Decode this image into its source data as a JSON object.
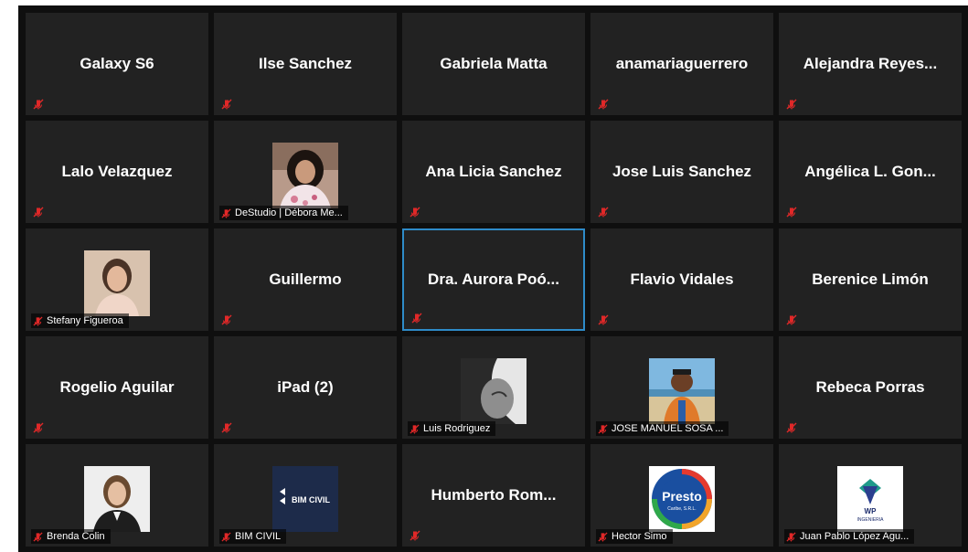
{
  "accent": {
    "active_border": "#2e8bc8",
    "mute": "#e02828"
  },
  "participants": [
    {
      "name": "Galaxy S6",
      "has_video": false,
      "muted": true
    },
    {
      "name": "Ilse Sanchez",
      "has_video": false,
      "muted": true
    },
    {
      "name": "Gabriela Matta",
      "has_video": false,
      "muted": false
    },
    {
      "name": "anamariaguerrero",
      "has_video": false,
      "muted": true
    },
    {
      "name": "Alejandra  Reyes...",
      "has_video": false,
      "muted": true
    },
    {
      "name": "Lalo Velazquez",
      "has_video": false,
      "muted": true
    },
    {
      "name": "DeStudio | Débora Me...",
      "has_video": true,
      "muted": true,
      "photo": "woman-curly-hair"
    },
    {
      "name": "Ana Licia Sanchez",
      "has_video": false,
      "muted": true
    },
    {
      "name": "Jose Luis Sanchez",
      "has_video": false,
      "muted": true
    },
    {
      "name": "Angélica L. Gon...",
      "has_video": false,
      "muted": true
    },
    {
      "name": "Stefany Figueroa",
      "has_video": true,
      "muted": true,
      "photo": "woman-portrait"
    },
    {
      "name": "Guillermo",
      "has_video": false,
      "muted": true
    },
    {
      "name": "Dra. Aurora Poó...",
      "has_video": false,
      "muted": true,
      "active": true
    },
    {
      "name": "Flavio Vidales",
      "has_video": false,
      "muted": true
    },
    {
      "name": "Berenice Limón",
      "has_video": false,
      "muted": true
    },
    {
      "name": "Rogelio Aguilar",
      "has_video": false,
      "muted": true
    },
    {
      "name": "iPad (2)",
      "has_video": false,
      "muted": true
    },
    {
      "name": "Luis Rodriguez",
      "has_video": true,
      "muted": true,
      "photo": "grayscale-face"
    },
    {
      "name": "JOSE MANUEL SOSA ...",
      "has_video": true,
      "muted": true,
      "photo": "cyclist-beach"
    },
    {
      "name": "Rebeca Porras",
      "has_video": false,
      "muted": true
    },
    {
      "name": "Brenda Colin",
      "has_video": true,
      "muted": true,
      "photo": "woman-smiling"
    },
    {
      "name": "BIM CIVIL",
      "has_video": true,
      "muted": true,
      "photo": "bim-civil-logo",
      "logo_text": "BIM CIVIL"
    },
    {
      "name": "Humberto  Rom...",
      "has_video": false,
      "muted": true
    },
    {
      "name": "Hector Simo",
      "has_video": true,
      "muted": true,
      "photo": "presto-logo",
      "logo_text": "Presto",
      "logo_subtext": "Caribe, S.R.L."
    },
    {
      "name": "Juan Pablo López Agu...",
      "has_video": true,
      "muted": true,
      "photo": "wp-logo",
      "logo_text": "WP",
      "logo_subtext": "INGENIERIA"
    }
  ]
}
